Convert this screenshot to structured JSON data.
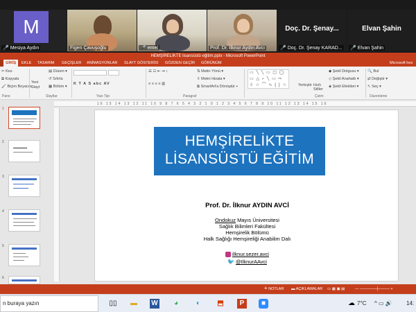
{
  "zoom": {
    "participants": [
      {
        "name": "Mesiya Aydın",
        "avatar_letter": "M"
      },
      {
        "name": "Figen Çavuşoğlu"
      },
      {
        "name": "emel"
      },
      {
        "name": "Prof. Dr. İlknur Aydın Avcı"
      },
      {
        "name": "Doç. Dr. Şenay KARAD...",
        "big_label": "Doç. Dr. Şenay..."
      },
      {
        "name": "Elvan Şahin",
        "big_label": "Elvan Şahin"
      }
    ]
  },
  "window": {
    "title": "HEMŞİRELİKTE lisansüstü eğitim.pptx - Microsoft PowerPoint",
    "account": "Microsoft hes"
  },
  "ribbon": {
    "tabs": [
      "GİRİŞ",
      "EKLE",
      "TASARIM",
      "GEÇİŞLER",
      "ANİMASYONLAR",
      "SLAYT GÖSTERİSİ",
      "GÖZDEN GEÇİR",
      "GÖRÜNÜM"
    ],
    "active_tab": "GİRİŞ",
    "clipboard": {
      "cut": "Kes",
      "copy": "Kopyala",
      "format_painter": "Biçim Boyacısı",
      "group": "Pano"
    },
    "slides": {
      "new_slide": "Yeni Slayt",
      "layout": "Düzen",
      "reset": "Sıfırla",
      "section": "Bölüm",
      "group": "Slaytlar"
    },
    "font": {
      "buttons": "K T A S abc AV",
      "group": "Yazı Tipi"
    },
    "paragraph": {
      "text_direction": "Metin Yönü",
      "align_text": "Metni Hizala",
      "smartart": "SmartArt'a Dönüştür",
      "group": "Paragraf"
    },
    "drawing": {
      "arrange": "Yerleştir",
      "quick_styles": "Hızlı Stiller",
      "fill": "Şekil Dolgusu",
      "outline": "Şekil Anahattı",
      "effects": "Şekil Efektleri",
      "group": "Çizim"
    },
    "editing": {
      "find": "Bul",
      "replace": "Değiştir",
      "select": "Seç",
      "group": "Düzenleme"
    },
    "ruler_ticks": "16 15 14 13 12 11 10 9 8 7 6 5 4 3 2 1 0 1 2 3 4 5 6 7 8 9 10 11 12 13 14 15 16"
  },
  "thumbnails": [
    {
      "number": "1",
      "selected": true
    },
    {
      "number": "2",
      "selected": false
    },
    {
      "number": "3",
      "selected": false
    },
    {
      "number": "4",
      "selected": false
    },
    {
      "number": "5",
      "selected": false
    },
    {
      "number": "6",
      "selected": false
    }
  ],
  "slide": {
    "title_line1": "HEMŞİRELİKTE",
    "title_line2": "LİSANSÜSTÜ EĞİTİM",
    "author": "Prof. Dr. İlknur AYDIN AVCİ",
    "affil_u": "Ondokuz",
    "affil_rest": " Mayıs Üniversitesi",
    "faculty": "Sağlık Bilimleri Fakültesi",
    "department": "Hemşirelik Bölümü",
    "division": "Halk Sağlığı Hemşireliği Anabilim Dalı",
    "instagram": "ilknur.sezer.avci",
    "twitter": "@IlknurAAvci"
  },
  "status": {
    "notes": "NOTLAR",
    "comments": "AÇIKLAMALAR"
  },
  "taskbar": {
    "search_placeholder": "n buraya yazın",
    "weather": "7°C",
    "time": "14:"
  },
  "colors": {
    "powerpoint_accent": "#c43e1c",
    "title_box": "#1e73be"
  }
}
